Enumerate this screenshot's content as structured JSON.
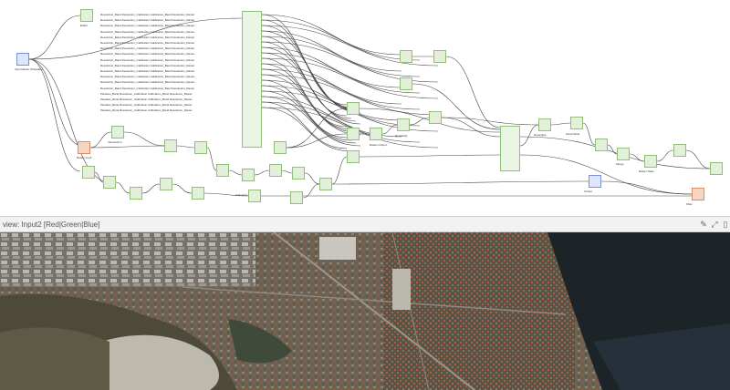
{
  "workflow": {
    "source_label": "Input Raster (Pleiades)",
    "preview_title": "view: Input2 [Red|Green|Blue]",
    "node_labels": [
      "Buffer",
      "Raster Input",
      "Intersection",
      "Calculator",
      "Raster Output",
      "Reclassify",
      "Zonal Stats",
      "Merge",
      "Filter",
      "Resample",
      "Raster Stats",
      "Output"
    ],
    "text_block": [
      "Resolution_Band Resolution_Calibration.Calibration_Band Resolution_Raster",
      "Resolution_Band Resolution_Calibration.Calibration_Band Resolution_Raster",
      "Resolution_Band Resolution_Calibration.Calibration_Band Resolution_Raster",
      "Resolution_Band Resolution_Calibration.Calibration_Band Resolution_Raster",
      "Resolution_Band Resolution_Calibration.Calibration_Band Resolution_Raster",
      "Resolution_Band Resolution_Calibration.Calibration_Band Resolution_Raster",
      "Resolution_Band Resolution_Calibration.Calibration_Band Resolution_Raster",
      "Resolution_Band Resolution_Calibration.Calibration_Band Resolution_Raster",
      "Resolution_Band Resolution_Calibration.Calibration_Band Resolution_Raster",
      "Resolution_Band Resolution_Calibration.Calibration_Band Resolution_Raster",
      "Resolution_Band Resolution_Calibration.Calibration_Band Resolution_Raster",
      "Resolution_Band Resolution_Calibration.Calibration_Band Resolution_Raster",
      "Resolution_Band Resolution_Calibration.Calibration_Band Resolution_Raster",
      "Resolution_Band Resolution_Calibration.Calibration_Band Resolution_Raster",
      "Pleiades_Band Resolution_Calibration.Calibration_Band Resolution_Raster",
      "Pleiades_Band Resolution_Calibration.Calibration_Band Resolution_Raster",
      "Pleiades_Band Resolution_Calibration.Calibration_Band Resolution_Raster",
      "Pleiades_Band Resolution_Calibration.Calibration_Band Resolution_Raster"
    ],
    "colors": {
      "node_green": "#e2f0d9",
      "node_blue": "#dde6fb",
      "node_orange": "#f7d5c3",
      "edge": "#444444"
    }
  },
  "toolbar": {
    "icons": [
      "pencil-icon",
      "expand-icon",
      "panel-icon"
    ]
  }
}
